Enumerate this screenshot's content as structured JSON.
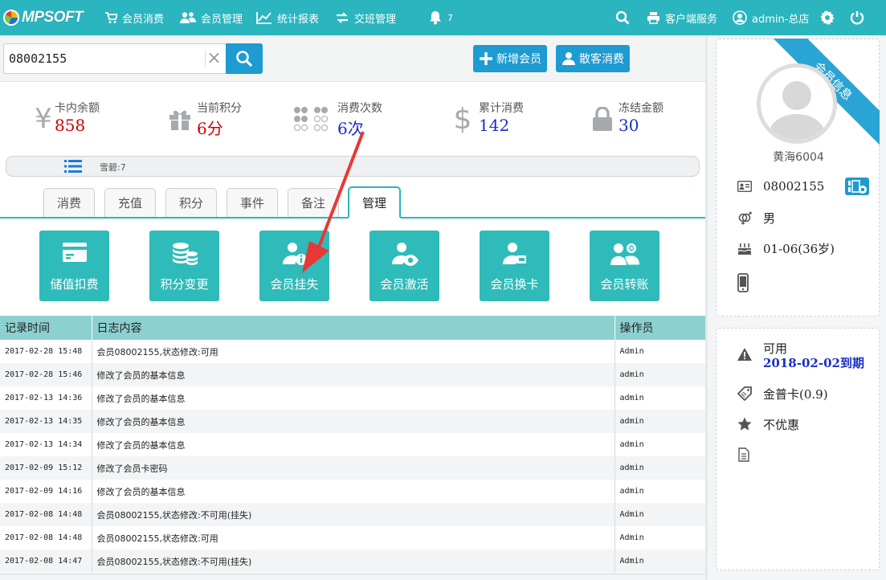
{
  "app": {
    "logo_text": "MPSOFT",
    "nav": [
      {
        "label": "会员消费",
        "icon": "cart-icon"
      },
      {
        "label": "会员管理",
        "icon": "users-icon"
      },
      {
        "label": "统计报表",
        "icon": "chart-icon"
      },
      {
        "label": "交班管理",
        "icon": "shift-icon"
      }
    ],
    "notifications": "7",
    "client_service": "客户端服务",
    "user": "admin-总店"
  },
  "search": {
    "value": "08002155",
    "clear": "×"
  },
  "actions": {
    "new_member": "新增会员",
    "walkin": "散客消费"
  },
  "stats": [
    {
      "label": "卡内余额",
      "value": "858",
      "color": "#d00000",
      "icon": "yen-icon"
    },
    {
      "label": "当前积分",
      "value": "6分",
      "color": "#d00000",
      "icon": "gift-icon"
    },
    {
      "label": "消费次数",
      "value": "6次",
      "color": "#1a2fc7",
      "icon": "dots-icon"
    },
    {
      "label": "累计消费",
      "value": "142",
      "color": "#1a2fc7",
      "icon": "dollar-icon"
    },
    {
      "label": "冻结金额",
      "value": "30",
      "color": "#1a2fc7",
      "icon": "lock-icon"
    }
  ],
  "infobar": {
    "text": "雪碧:7"
  },
  "tabs": [
    {
      "label": "消费"
    },
    {
      "label": "充值"
    },
    {
      "label": "积分"
    },
    {
      "label": "事件"
    },
    {
      "label": "备注"
    },
    {
      "label": "管理",
      "active": true
    }
  ],
  "tiles": [
    {
      "label": "储值扣费",
      "icon": "card-icon"
    },
    {
      "label": "积分变更",
      "icon": "coins-icon"
    },
    {
      "label": "会员挂失",
      "icon": "user-info-icon"
    },
    {
      "label": "会员激活",
      "icon": "user-eye-icon"
    },
    {
      "label": "会员换卡",
      "icon": "user-card-icon"
    },
    {
      "label": "会员转账",
      "icon": "user-transfer-icon"
    }
  ],
  "log": {
    "headers": [
      "记录时间",
      "日志内容",
      "操作员"
    ],
    "rows": [
      [
        "2017-02-28 15:48",
        "会员08002155,状态修改:可用",
        "Admin"
      ],
      [
        "2017-02-28 15:46",
        "修改了会员的基本信息",
        "admin"
      ],
      [
        "2017-02-13 14:36",
        "修改了会员的基本信息",
        "admin"
      ],
      [
        "2017-02-13 14:35",
        "修改了会员的基本信息",
        "admin"
      ],
      [
        "2017-02-13 14:34",
        "修改了会员的基本信息",
        "admin"
      ],
      [
        "2017-02-09 15:12",
        "修改了会员卡密码",
        "admin"
      ],
      [
        "2017-02-09 14:16",
        "修改了会员的基本信息",
        "admin"
      ],
      [
        "2017-02-08 14:48",
        "会员08002155,状态修改:不可用(挂失)",
        "Admin"
      ],
      [
        "2017-02-08 14:48",
        "会员08002155,状态修改:可用",
        "Admin"
      ],
      [
        "2017-02-08 14:47",
        "会员08002155,状态修改:不可用(挂失)",
        "Admin"
      ]
    ]
  },
  "member": {
    "ribbon": "会员信息",
    "name": "黄海6004",
    "card_no": "08002155",
    "gender": "男",
    "birthday": "01-06(36岁)",
    "phone": "",
    "status": "可用",
    "expiry": "2018-02-02到期",
    "card_type": "金普卡(0.9)",
    "discount": "不优惠",
    "note": ""
  },
  "colors": {
    "topbar": "#2ab5bf",
    "button": "#1e9bd1",
    "tile": "#2fbbb9",
    "table_header": "#8dd0d0",
    "arrow": "#e53935"
  }
}
